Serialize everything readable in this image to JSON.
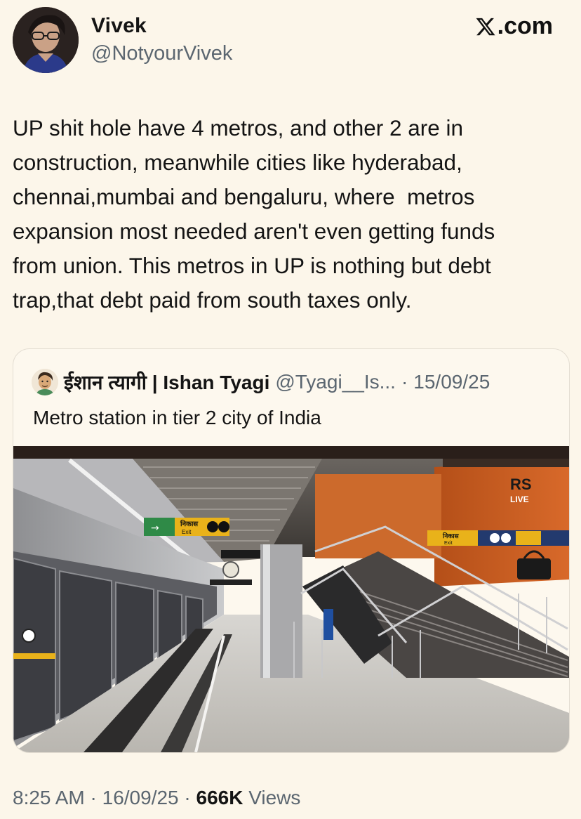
{
  "author": {
    "display_name": "Vivek",
    "handle": "@NotyourVivek",
    "avatar_icon": "profile-photo"
  },
  "brand": {
    "label": ".com",
    "logo_icon": "x-logo-icon"
  },
  "tweet": {
    "text": "UP shit hole have 4 metros, and other 2 are in\nconstruction, meanwhile cities like hyderabad,\nchennai,mumbai and bengaluru, where  metros\nexpansion most needed aren't even getting funds\nfrom union. This metros in UP is nothing but debt\ntrap,that debt paid from south taxes only."
  },
  "quoted_tweet": {
    "author_name": "ईशान त्यागी | Ishan Tyagi",
    "author_handle": "@Tyagi__Is...",
    "separator": "·",
    "date": "15/09/25",
    "text": "Metro station in tier 2 city of India",
    "image": {
      "subject": "metro-station-platform-photo",
      "signs": {
        "exit_sign_left": "निकास",
        "exit_sign_left_sub": "Exit",
        "exit_sign_right": "निकास",
        "exit_sign_right_sub": "Exit",
        "watermark_top": "RS",
        "watermark_bottom": "LIVE"
      }
    }
  },
  "meta": {
    "time": "8:25 AM",
    "separator": "·",
    "date": "16/09/25",
    "views_count": "666K",
    "views_label": "Views"
  },
  "colors": {
    "background": "#FCF6EA",
    "text_primary": "#141414",
    "text_secondary": "#5B6670",
    "card_border": "#E3DDD2",
    "sign_yellow": "#E9B21A",
    "wall_orange": "#C65B1E"
  }
}
